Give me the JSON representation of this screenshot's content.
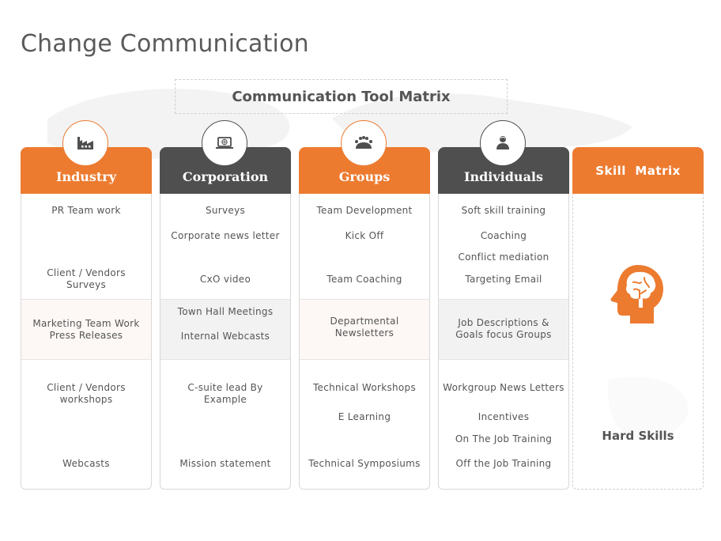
{
  "page": {
    "title": "Change Communication",
    "matrix_title": "Communication Tool Matrix"
  },
  "colors": {
    "accent_orange": "#ec7b30",
    "header_dark": "#4f4f4f",
    "text_gray": "#555555"
  },
  "columns": [
    {
      "label": "Industry",
      "icon": "factory-icon",
      "style": "orange",
      "top_items": [
        "PR Team work",
        "",
        "Client / Vendors\nSurveys"
      ],
      "band_items": [
        "Marketing Team Work\nPress Releases"
      ],
      "bottom_items": [
        "Client / Vendors\nworkshops",
        "",
        "Webcasts"
      ]
    },
    {
      "label": "Corporation",
      "icon": "laptop-globe-icon",
      "style": "dark",
      "top_items": [
        "Surveys",
        "Corporate news letter",
        "CxO video"
      ],
      "band_items": [
        "Town Hall  Meetings",
        "Internal  Webcasts"
      ],
      "bottom_items": [
        "C-suite lead By\nExample",
        "",
        "Mission  statement"
      ]
    },
    {
      "label": "Groups",
      "icon": "group-meeting-icon",
      "style": "orange",
      "top_items": [
        "Team Development",
        "Kick Off",
        "Team Coaching"
      ],
      "band_items": [
        "Departmental\nNewsletters"
      ],
      "bottom_items": [
        "Technical Workshops",
        "E Learning",
        "Technical Symposiums"
      ]
    },
    {
      "label": "Individuals",
      "icon": "person-icon",
      "style": "dark",
      "top_items": [
        "Soft skill  training",
        "Coaching",
        "Conflict mediation",
        "Targeting Email"
      ],
      "band_items": [
        "Job Descriptions  &\nGoals  focus Groups"
      ],
      "bottom_items": [
        "Workgroup  News Letters",
        "Incentives",
        "On The Job Training",
        "Off the Job Training"
      ]
    }
  ],
  "skill_matrix": {
    "label": "Skill  Matrix",
    "icon": "head-brain-icon",
    "hard_skills": "Hard Skills"
  }
}
